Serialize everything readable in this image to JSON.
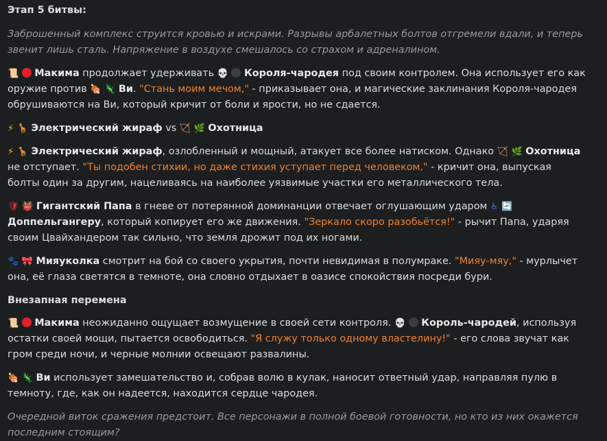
{
  "title": "Этап 5 битвы:",
  "intro": "Заброшенный комплекс струится кровью и искрами. Разрывы арбалетных болтов отгремели вдали, и теперь звенит лишь сталь. Напряжение в воздухе смешалось со страхом и адреналином.",
  "p1": {
    "name1": "Макима",
    "t1": " продолжает удерживать ",
    "name2": "Короля-чародея",
    "t2": " под своим контролем. Она использует его как оружие против ",
    "name3": "Ви",
    "t3": ". ",
    "quote": "\"Стань моим мечом,\"",
    "t4": " - приказывает она, и магические заклинания Короля-чародея обрушиваются на Ви, который кричит от боли и ярости, но не сдается."
  },
  "vs": {
    "name1": "Электрический жираф",
    "t": " vs ",
    "name2": "Охотница"
  },
  "p2": {
    "name1": "Электрический жираф",
    "t1": ", озлобленный и мощный, атакует все более натиском. Однако ",
    "name2": "Охотница",
    "t2": " не отступает. ",
    "quote": "\"Ты подобен стихии, но даже стихия уступает перед человеком,\"",
    "t3": " - кричит она, выпуская болты один за другим, нацеливаясь на наиболее уязвимые участки его металлического тела."
  },
  "p3": {
    "name1": "Гигантский Папа",
    "t1": " в гневе от потерянной доминанции отвечает оглушающим ударом ",
    "name2": "Доппельгангеру",
    "t2": ", который копирует его же движения. ",
    "quote": "\"Зеркало скоро разобьётся!\"",
    "t3": " - рычит Папа, ударяя своим Цвайхандером так сильно, что земля дрожит под их ногами."
  },
  "p4": {
    "name1": "Мияуколка",
    "t1": " смотрит на бой со своего укрытия, почти невидимая в полумраке. ",
    "quote": "\"Мияу-мяу,\"",
    "t2": " - мурлычет она, её глаза светятся в темноте, она словно отдыхает в оазисе спокойствия посреди бури."
  },
  "subheading": "Внезапная перемена",
  "p5": {
    "name1": "Макима",
    "t1": " неожиданно ощущает возмущение в своей сети контроля. ",
    "name2": "Король-чародей",
    "t2": ", используя остатки своей мощи, пытается освободиться. ",
    "quote": "\"Я служу только одному властелину!\"",
    "t3": " - его слова звучат как гром среди ночи, и черные молнии освещают развалины."
  },
  "p6": {
    "name1": "Ви",
    "t1": " использует замешательство и, собрав волю в кулак, наносит ответный удар, направляя пулю в темноту, где, как он надеется, находится сердце чародея."
  },
  "outro": "Очередной виток сражения предстоит. Все персонажи в полной боевой готовности, но кто из них окажется последним стоящим?"
}
